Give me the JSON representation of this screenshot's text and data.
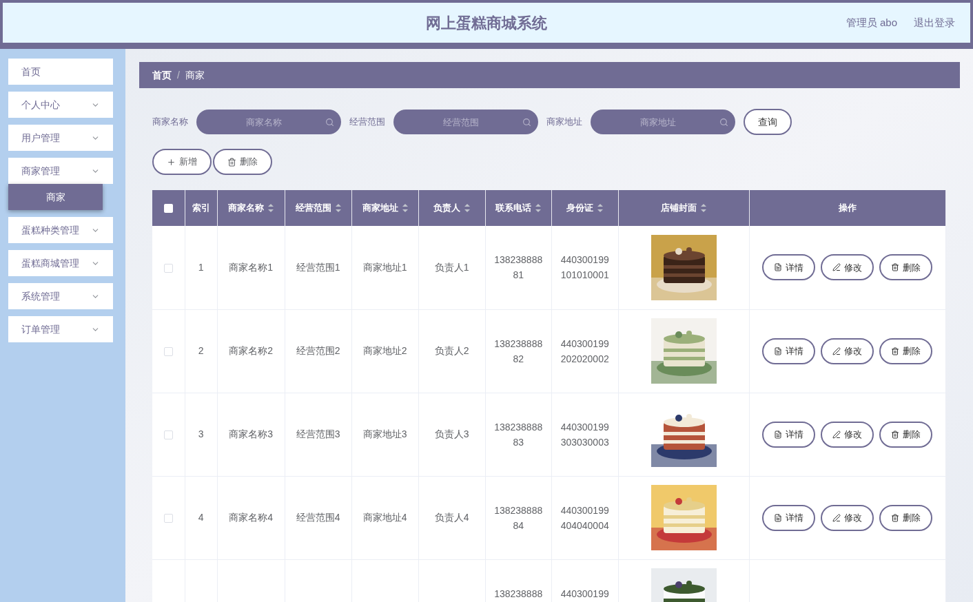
{
  "header": {
    "title": "网上蛋糕商城系统",
    "user": "管理员 abo",
    "logout": "退出登录"
  },
  "sidebar": {
    "items": [
      {
        "kind": "link",
        "label": "首页"
      },
      {
        "kind": "menu",
        "label": "个人中心"
      },
      {
        "kind": "menu",
        "label": "用户管理"
      },
      {
        "kind": "menu",
        "label": "商家管理",
        "children": [
          {
            "label": "商家",
            "selected": true
          }
        ]
      },
      {
        "kind": "menu",
        "label": "蛋糕种类管理"
      },
      {
        "kind": "menu",
        "label": "蛋糕商城管理"
      },
      {
        "kind": "menu",
        "label": "系统管理"
      },
      {
        "kind": "menu",
        "label": "订单管理"
      }
    ]
  },
  "breadcrumb": {
    "items": [
      "首页",
      "商家"
    ],
    "separator": "/"
  },
  "filters": [
    {
      "label": "商家名称",
      "placeholder": "商家名称"
    },
    {
      "label": "经营范围",
      "placeholder": "经营范围"
    },
    {
      "label": "商家地址",
      "placeholder": "商家地址"
    }
  ],
  "search_button": "查询",
  "actions": [
    {
      "kind": "add",
      "label": "新增"
    },
    {
      "kind": "delete",
      "label": "删除"
    }
  ],
  "table": {
    "select_all": {
      "checked": false
    },
    "columns": [
      {
        "label": "索引",
        "kind": "plain"
      },
      {
        "label": "商家名称",
        "kind": "sortable"
      },
      {
        "label": "经营范围",
        "kind": "sortable"
      },
      {
        "label": "商家地址",
        "kind": "sortable"
      },
      {
        "label": "负责人",
        "kind": "sortable"
      },
      {
        "label": "联系电话",
        "kind": "sortable"
      },
      {
        "label": "身份证",
        "kind": "sortable"
      },
      {
        "label": "店铺封面",
        "kind": "sortable"
      },
      {
        "label": "操作",
        "kind": "plain"
      }
    ],
    "rows": [
      {
        "checked": false,
        "index": "1",
        "name": "商家名称1",
        "scope": "经营范围1",
        "address": "商家地址1",
        "manager": "负责人1",
        "phone": "13823888881",
        "id_card": "440300199101010001",
        "buttons": [
          {
            "kind": "detail",
            "label": "详情"
          },
          {
            "kind": "edit",
            "label": "修改"
          },
          {
            "kind": "delete",
            "label": "删除"
          }
        ]
      },
      {
        "checked": false,
        "index": "2",
        "name": "商家名称2",
        "scope": "经营范围2",
        "address": "商家地址2",
        "manager": "负责人2",
        "phone": "13823888882",
        "id_card": "440300199202020002",
        "buttons": [
          {
            "kind": "detail",
            "label": "详情"
          },
          {
            "kind": "edit",
            "label": "修改"
          },
          {
            "kind": "delete",
            "label": "删除"
          }
        ]
      },
      {
        "checked": false,
        "index": "3",
        "name": "商家名称3",
        "scope": "经营范围3",
        "address": "商家地址3",
        "manager": "负责人3",
        "phone": "13823888883",
        "id_card": "440300199303030003",
        "buttons": [
          {
            "kind": "detail",
            "label": "详情"
          },
          {
            "kind": "edit",
            "label": "修改"
          },
          {
            "kind": "delete",
            "label": "删除"
          }
        ]
      },
      {
        "checked": false,
        "index": "4",
        "name": "商家名称4",
        "scope": "经营范围4",
        "address": "商家地址4",
        "manager": "负责人4",
        "phone": "13823888884",
        "id_card": "440300199404040004",
        "buttons": [
          {
            "kind": "detail",
            "label": "详情"
          },
          {
            "kind": "edit",
            "label": "修改"
          },
          {
            "kind": "delete",
            "label": "删除"
          }
        ]
      },
      {
        "phone": "138238888",
        "id_card": "440300199"
      }
    ]
  }
}
